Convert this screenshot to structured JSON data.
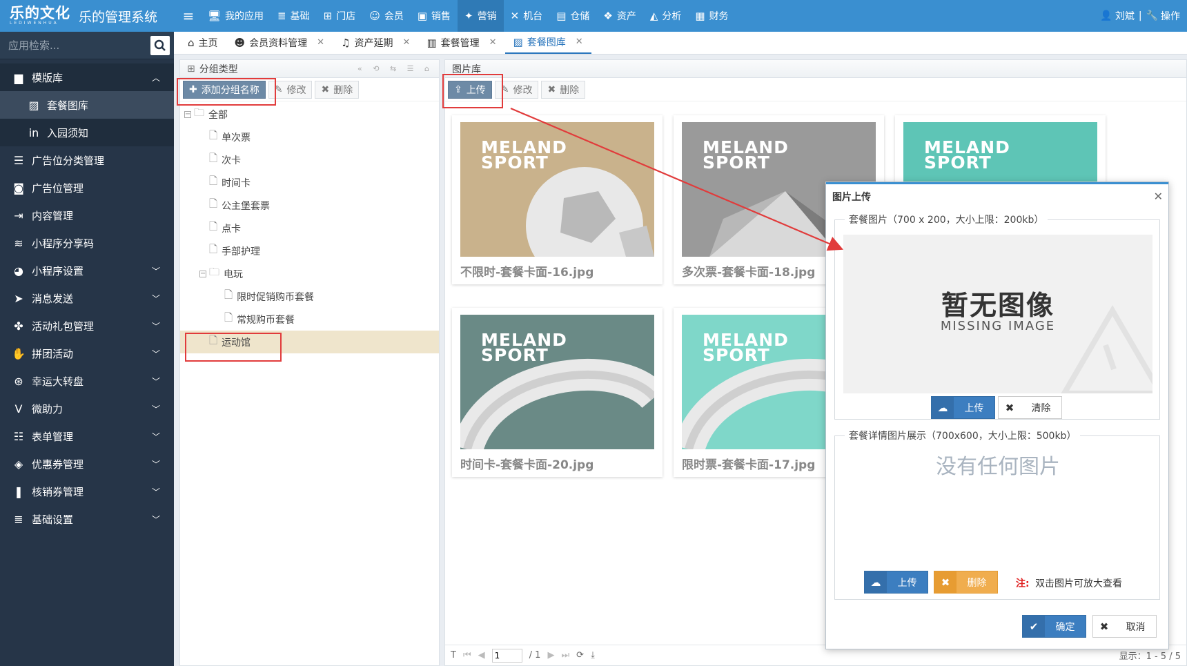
{
  "brand": {
    "logo_text": "乐的文化",
    "logo_sub": "LEDIWENHUA",
    "title": "乐的管理系统"
  },
  "topnav": [
    {
      "label": "我的应用",
      "icon": "monitor-icon"
    },
    {
      "label": "基础",
      "icon": "database-icon"
    },
    {
      "label": "门店",
      "icon": "sitemap-icon"
    },
    {
      "label": "会员",
      "icon": "user-tie-icon"
    },
    {
      "label": "销售",
      "icon": "briefcase-icon"
    },
    {
      "label": "营销",
      "icon": "marketing-icon"
    },
    {
      "label": "机台",
      "icon": "joomla-icon"
    },
    {
      "label": "仓储",
      "icon": "warehouse-icon"
    },
    {
      "label": "资产",
      "icon": "cubes-icon"
    },
    {
      "label": "分析",
      "icon": "area-chart-icon"
    },
    {
      "label": "财务",
      "icon": "calculator-icon"
    }
  ],
  "user": {
    "name": "刘斌",
    "ops": "操作"
  },
  "sidebar": {
    "search_placeholder": "应用检索...",
    "items": [
      {
        "label": "模版库",
        "icon": "archive-icon",
        "expanded": true
      },
      {
        "label": "套餐图库",
        "icon": "image-icon",
        "sub": true,
        "active": true
      },
      {
        "label": "入园须知",
        "icon": "linkedin-icon",
        "sub": true
      },
      {
        "label": "广告位分类管理",
        "icon": "list-icon"
      },
      {
        "label": "广告位管理",
        "icon": "gamepad-icon"
      },
      {
        "label": "内容管理",
        "icon": "sign-in-icon"
      },
      {
        "label": "小程序分享码",
        "icon": "rss-icon"
      },
      {
        "label": "小程序设置",
        "icon": "palette-icon",
        "chevron": true
      },
      {
        "label": "消息发送",
        "icon": "paper-plane-icon",
        "chevron": true
      },
      {
        "label": "活动礼包管理",
        "icon": "gift-icon",
        "chevron": true
      },
      {
        "label": "拼团活动",
        "icon": "hand-icon",
        "chevron": true
      },
      {
        "label": "幸运大转盘",
        "icon": "dribbble-icon",
        "chevron": true
      },
      {
        "label": "微助力",
        "icon": "vimeo-icon",
        "chevron": true
      },
      {
        "label": "表单管理",
        "icon": "form-icon",
        "chevron": true
      },
      {
        "label": "优惠券管理",
        "icon": "tag-icon",
        "chevron": true
      },
      {
        "label": "核销券管理",
        "icon": "bookmark-icon",
        "chevron": true
      },
      {
        "label": "基础设置",
        "icon": "database-icon",
        "chevron": true
      }
    ]
  },
  "tabs": [
    {
      "label": "主页",
      "icon": "home-icon",
      "closable": false
    },
    {
      "label": "会员资料管理",
      "icon": "users-icon",
      "closable": true
    },
    {
      "label": "资产延期",
      "icon": "bell-icon",
      "closable": true
    },
    {
      "label": "套餐管理",
      "icon": "shopping-bag-icon",
      "closable": true
    },
    {
      "label": "套餐图库",
      "icon": "image-icon",
      "closable": true,
      "active": true
    }
  ],
  "group_panel": {
    "title": "分组类型",
    "add_label": "添加分组名称",
    "edit_label": "修改",
    "delete_label": "删除",
    "tree": [
      {
        "label": "全部",
        "level": 0,
        "type": "folder"
      },
      {
        "label": "单次票",
        "level": 1,
        "type": "file"
      },
      {
        "label": "次卡",
        "level": 1,
        "type": "file"
      },
      {
        "label": "时间卡",
        "level": 1,
        "type": "file"
      },
      {
        "label": "公主堡套票",
        "level": 1,
        "type": "file"
      },
      {
        "label": "点卡",
        "level": 1,
        "type": "file"
      },
      {
        "label": "手部护理",
        "level": 1,
        "type": "file"
      },
      {
        "label": "电玩",
        "level": 1,
        "type": "folder"
      },
      {
        "label": "限时促销购币套餐",
        "level": 2,
        "type": "file"
      },
      {
        "label": "常规购币套餐",
        "level": 2,
        "type": "file"
      },
      {
        "label": "运动馆",
        "level": 1,
        "type": "file",
        "selected": true
      }
    ]
  },
  "gallery_panel": {
    "title": "图片库",
    "upload_label": "上传",
    "edit_label": "修改",
    "delete_label": "删除",
    "images": [
      {
        "name": "不限时-套餐卡面-16.jpg",
        "logo1": "MELAND",
        "logo2": "SPORT",
        "bg": "#c9b28c",
        "shape": "ball"
      },
      {
        "name": "多次票-套餐卡面-18.jpg",
        "logo1": "MELAND",
        "logo2": "SPORT",
        "bg": "#9a9a9a",
        "shape": "prism"
      },
      {
        "name": "",
        "logo1": "MELAND",
        "logo2": "SPORT",
        "bg": "#5ec5b6",
        "shape": "sphere"
      },
      {
        "name": "时间卡-套餐卡面-20.jpg",
        "logo1": "MELAND",
        "logo2": "SPORT",
        "bg": "#6a8a86",
        "shape": "ring"
      },
      {
        "name": "限时票-套餐卡面-17.jpg",
        "logo1": "MELAND",
        "logo2": "SPORT",
        "bg": "#7fd7c9",
        "shape": "ring"
      }
    ],
    "pager": {
      "page": "1",
      "total": "/ 1",
      "display": "显示：1 - 5 / 5"
    }
  },
  "dialog": {
    "title": "图片上传",
    "section1_legend": "套餐图片（700 x 200，大小上限：200kb）",
    "missing_cn": "暂无图像",
    "missing_en": "MISSING IMAGE",
    "upload_label": "上传",
    "clear_label": "清除",
    "section2_legend": "套餐详情图片展示（700x600，大小上限：500kb）",
    "no_image_text": "没有任何图片",
    "upload2_label": "上传",
    "delete_label": "删除",
    "note_prefix": "注:",
    "note_text": "双击图片可放大查看",
    "confirm_label": "确定",
    "cancel_label": "取消"
  },
  "colors": {
    "accent": "#3a8fd0",
    "sidebar": "#263548",
    "annotation": "#e13b3b"
  }
}
